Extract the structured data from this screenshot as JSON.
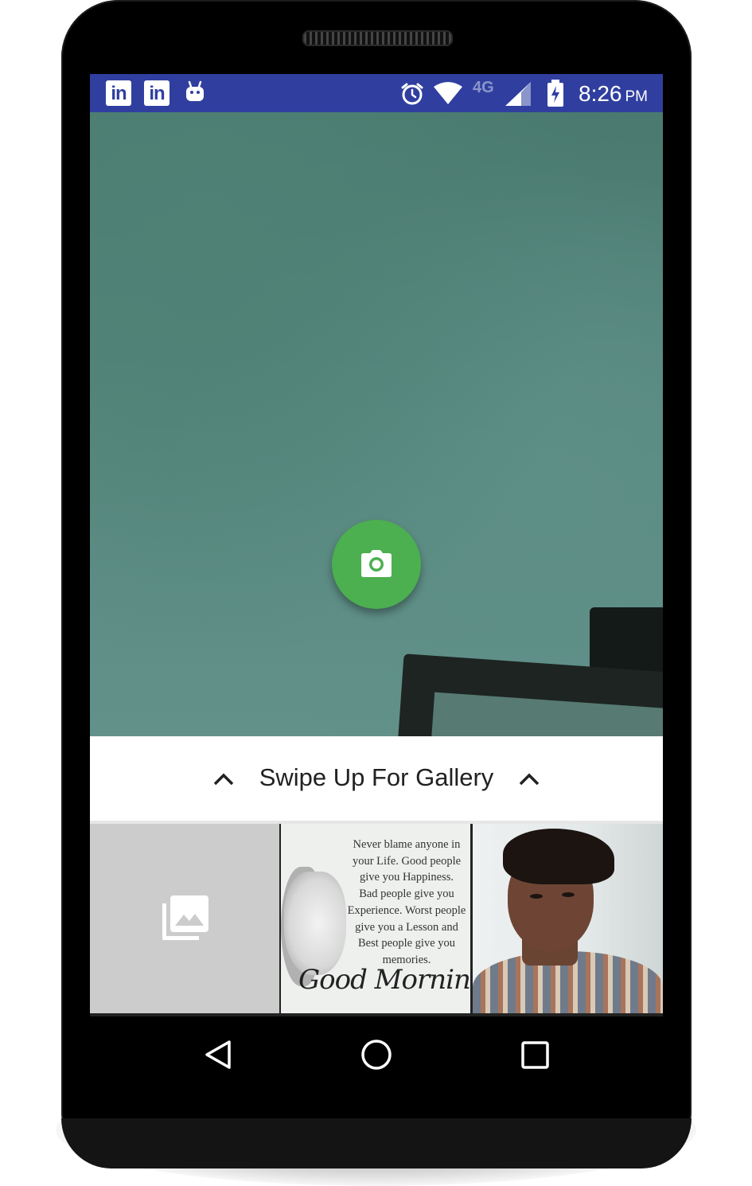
{
  "status_bar": {
    "left_icons": [
      "linkedin-icon",
      "linkedin-icon",
      "android-icon"
    ],
    "linkedin_text": "in",
    "network_label": "4G",
    "time": "8:26",
    "ampm": "PM",
    "right_icons": [
      "alarm-icon",
      "wifi-icon",
      "signal-icon",
      "battery-charging-icon"
    ]
  },
  "camera": {
    "capture_icon": "camera-icon"
  },
  "swipe_panel": {
    "label": "Swipe Up For Gallery",
    "icons": [
      "chevron-up-icon",
      "chevron-up-icon"
    ]
  },
  "gallery": {
    "items": [
      {
        "type": "gallery-placeholder",
        "icon": "photo-library-icon"
      },
      {
        "type": "quote-image",
        "quote_lines": [
          "Never blame anyone in",
          "your Life. Good people",
          "give you Happiness.",
          "Bad people give you",
          "Experience. Worst people",
          "give you a Lesson and",
          "Best people give you",
          "memories."
        ],
        "script_text": "Good Morning"
      },
      {
        "type": "photo",
        "subject": "portrait"
      }
    ]
  },
  "nav_bar": {
    "buttons": [
      "back-icon",
      "home-icon",
      "recents-icon"
    ]
  },
  "colors": {
    "status_bar": "#303f9f",
    "fab": "#4caf50",
    "panel": "#ffffff",
    "placeholder": "#cccccc"
  }
}
